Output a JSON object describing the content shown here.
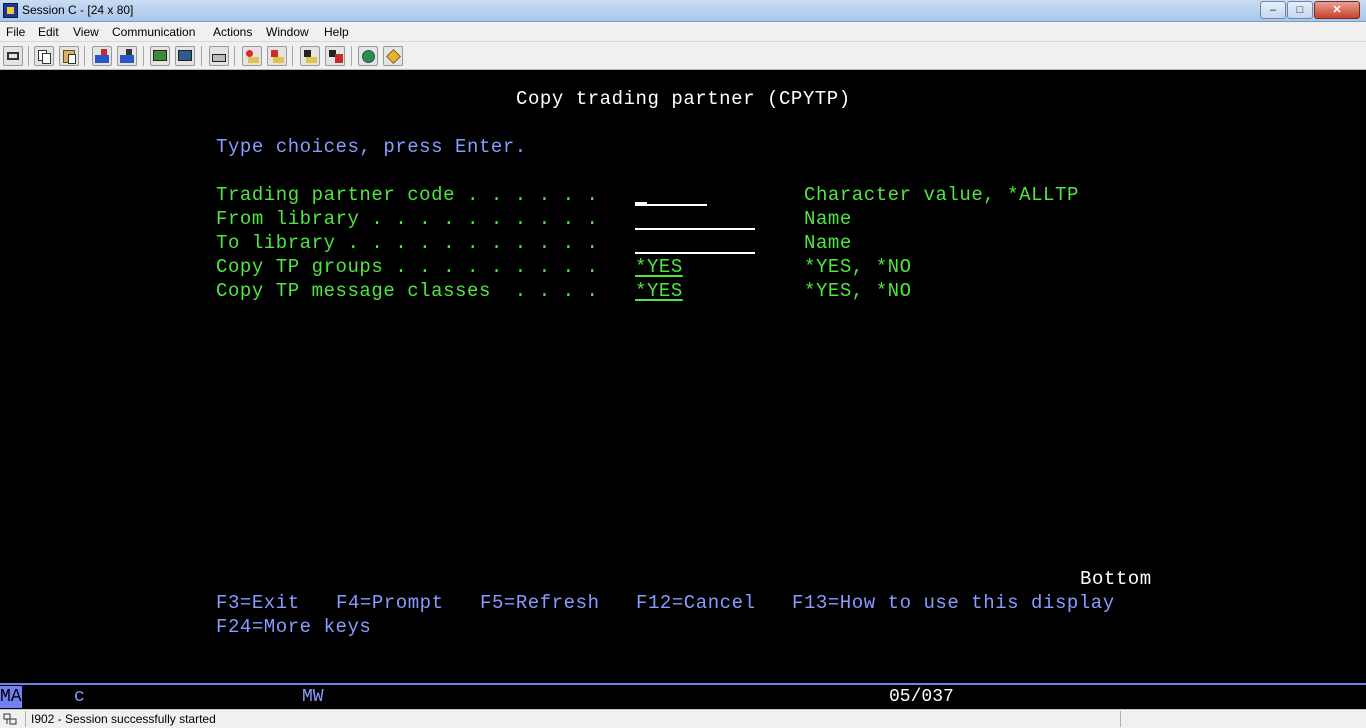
{
  "window": {
    "title": "Session C - [24 x 80]",
    "controls": {
      "minimize": "–",
      "maximize": "□",
      "close": "✕"
    }
  },
  "menu": [
    {
      "label": "File"
    },
    {
      "label": "Edit"
    },
    {
      "label": "View"
    },
    {
      "label": "Communication"
    },
    {
      "label": "Actions"
    },
    {
      "label": "Window"
    },
    {
      "label": "Help"
    }
  ],
  "toolbar": {
    "icons": [
      "print-screen-icon",
      "copy-icon",
      "paste-icon",
      "send-icon",
      "receive-icon",
      "display-icon",
      "keyboard-icon",
      "macro-icon",
      "record-macro-icon",
      "play-macro-icon",
      "stop-macro-icon",
      "stop-play-icon",
      "globe-icon",
      "edit-icon"
    ]
  },
  "screen": {
    "title": "Copy trading partner (CPYTP)",
    "instructions": "Type choices, press Enter.",
    "fields": [
      {
        "label": "Trading partner code . . . . . .",
        "value": "",
        "hint": "Character value, *ALLTP"
      },
      {
        "label": "From library . . . . . . . . . .",
        "value": "",
        "hint": "Name"
      },
      {
        "label": "To library . . . . . . . . . . .",
        "value": "",
        "hint": "Name"
      },
      {
        "label": "Copy TP groups . . . . . . . . .",
        "value": "*YES",
        "hint": "*YES, *NO"
      },
      {
        "label": "Copy TP message classes  . . . .",
        "value": "*YES",
        "hint": "*YES, *NO"
      }
    ],
    "position": "Bottom",
    "function_keys": {
      "f3": "F3=Exit",
      "f4": "F4=Prompt",
      "f5": "F5=Refresh",
      "f12": "F12=Cancel",
      "f13": "F13=How to use this display",
      "f24": "F24=More keys"
    },
    "colors": {
      "title": "#ffffff",
      "instruction": "#8a9bff",
      "field": "#4fe63f"
    }
  },
  "oia": {
    "ma": "MA",
    "session": "c",
    "mode": "MW",
    "cursor_position": "05/037"
  },
  "status": {
    "message": "I902 - Session successfully started"
  }
}
